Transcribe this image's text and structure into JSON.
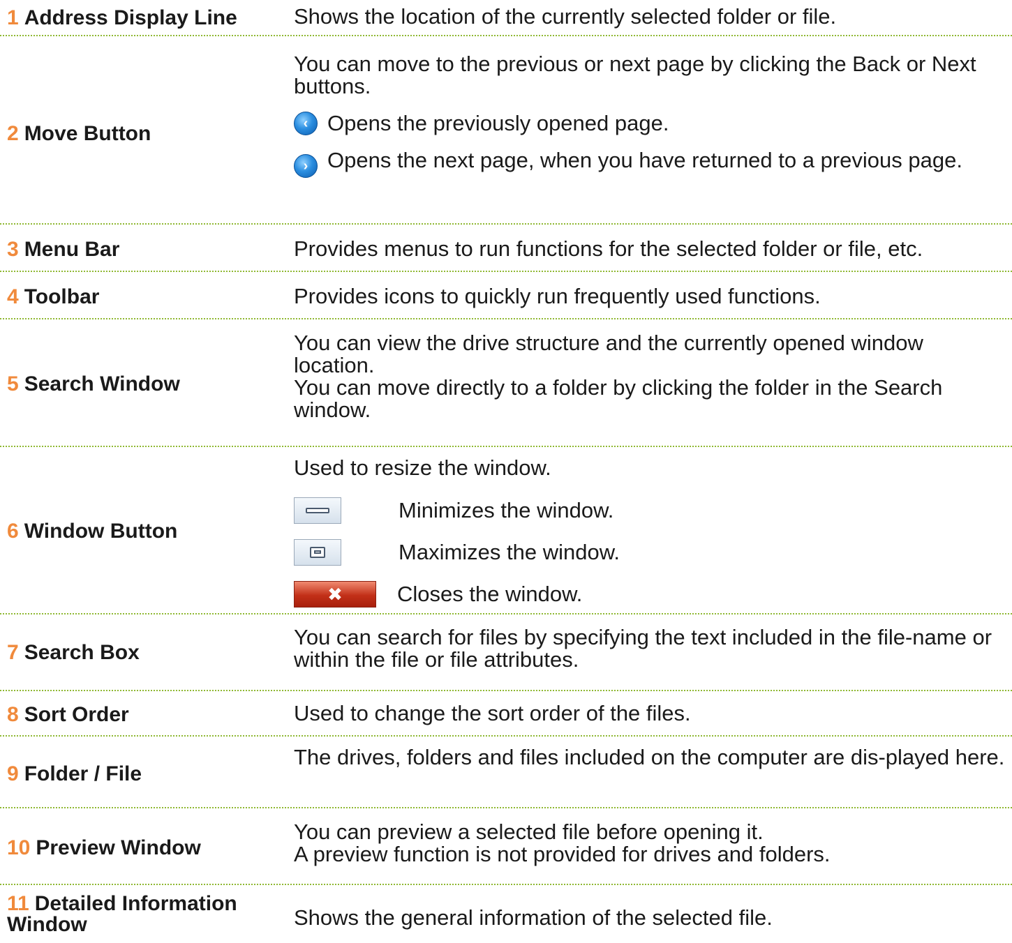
{
  "items": [
    {
      "number": "1",
      "term": "Address Display Line",
      "description": "Shows the location of the currently selected folder or file."
    },
    {
      "number": "2",
      "term": "Move Button",
      "description": "You can move to the previous or next page by clicking the Back or Next buttons.",
      "back_icon": "back-arrow-icon",
      "back_text": "Opens the previously opened page.",
      "next_icon": "next-arrow-icon",
      "next_text": "Opens the next page, when you have returned to a previous page."
    },
    {
      "number": "3",
      "term": "Menu Bar",
      "description": "Provides menus to run functions for the selected folder or file, etc."
    },
    {
      "number": "4",
      "term": "Toolbar",
      "description": "Provides icons to quickly run frequently used functions."
    },
    {
      "number": "5",
      "term": "Search Window",
      "description_line1": "You can view the drive structure and the currently opened window location.",
      "description_line2": "You can move directly to a folder by clicking the folder in the Search window."
    },
    {
      "number": "6",
      "term": "Window Button",
      "description": "Used to resize the window.",
      "minimize_icon": "minimize-icon",
      "minimize_text": "Minimizes the window.",
      "maximize_icon": "maximize-icon",
      "maximize_text": "Maximizes the window.",
      "close_icon": "close-icon",
      "close_text": "Closes the window."
    },
    {
      "number": "7",
      "term": "Search Box",
      "description": "You can search for files by specifying the text included in the file-name or within the file or file attributes."
    },
    {
      "number": "8",
      "term": "Sort Order",
      "description": "Used to change the sort order of the files."
    },
    {
      "number": "9",
      "term": "Folder / File",
      "description": "The drives, folders and files included on the computer are dis-played here."
    },
    {
      "number": "10",
      "term": "Preview Window",
      "description_line1": "You can preview a selected file before opening it.",
      "description_line2": "A preview function is not provided for drives and folders."
    },
    {
      "number": "11",
      "term": "Detailed Information Window",
      "description": "Shows the general information of the selected file."
    }
  ],
  "colors": {
    "number": "#f08a3c",
    "divider": "#8fb832",
    "text": "#1a1a1a"
  }
}
